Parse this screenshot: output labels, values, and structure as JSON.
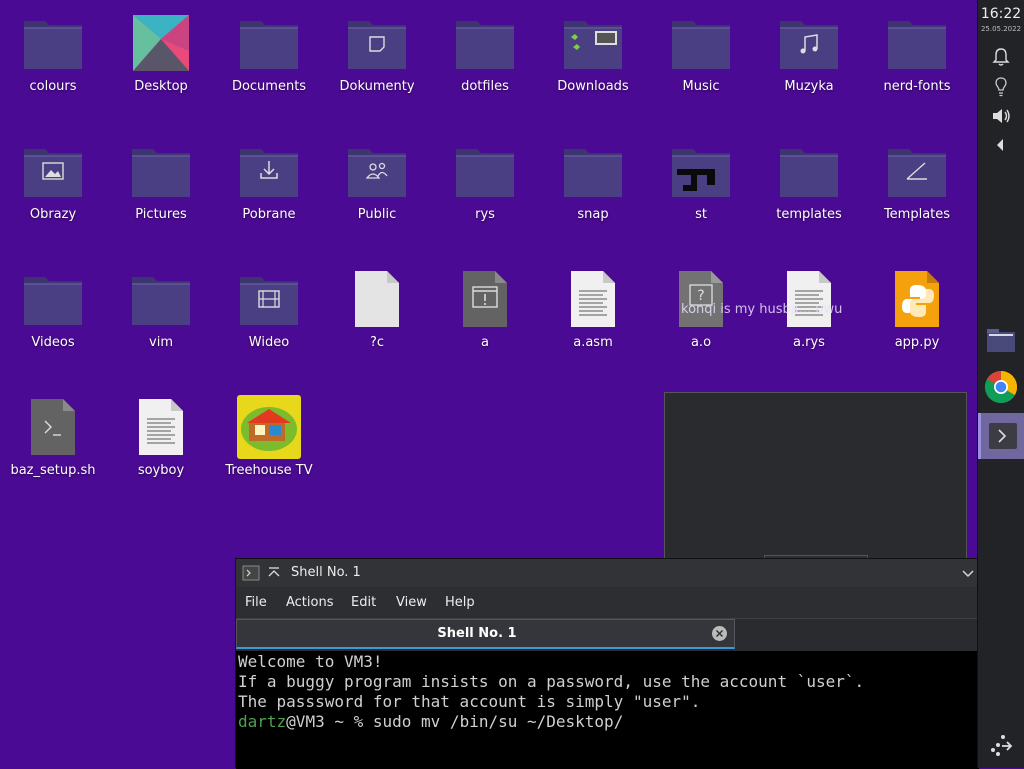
{
  "desktop": {
    "icons": [
      {
        "label": "colours",
        "type": "folder"
      },
      {
        "label": "Desktop",
        "type": "image"
      },
      {
        "label": "Documents",
        "type": "folder"
      },
      {
        "label": "Dokumenty",
        "type": "folder-document"
      },
      {
        "label": "dotfiles",
        "type": "folder"
      },
      {
        "label": "Downloads",
        "type": "folder-thumbnails"
      },
      {
        "label": "Music",
        "type": "folder"
      },
      {
        "label": "Muzyka",
        "type": "folder-music"
      },
      {
        "label": "nerd-fonts",
        "type": "folder"
      },
      {
        "label": "Obrazy",
        "type": "folder-pictures"
      },
      {
        "label": "Pictures",
        "type": "folder"
      },
      {
        "label": "Pobrane",
        "type": "folder-download"
      },
      {
        "label": "Public",
        "type": "folder-users"
      },
      {
        "label": "rys",
        "type": "folder"
      },
      {
        "label": "snap",
        "type": "folder"
      },
      {
        "label": "st",
        "type": "folder-st"
      },
      {
        "label": "templates",
        "type": "folder"
      },
      {
        "label": "Templates",
        "type": "folder-templates"
      },
      {
        "label": "Videos",
        "type": "folder"
      },
      {
        "label": "vim",
        "type": "folder"
      },
      {
        "label": "Wideo",
        "type": "folder-video"
      },
      {
        "label": "?c",
        "type": "file-blank"
      },
      {
        "label": "a",
        "type": "file-executable"
      },
      {
        "label": "a.asm",
        "type": "file-text"
      },
      {
        "label": "a.o",
        "type": "file-unknown"
      },
      {
        "label": "a.rys",
        "type": "file-text"
      },
      {
        "label": "app.py",
        "type": "file-python"
      },
      {
        "label": "baz_setup.sh",
        "type": "file-shell"
      },
      {
        "label": "soyboy",
        "type": "file-text"
      },
      {
        "label": "Treehouse TV",
        "type": "image-treehouse"
      }
    ],
    "tooltip": "konqi is my husba... uwu"
  },
  "panel": {
    "clock_time": "16:22",
    "clock_date": "25.05.2022",
    "tray_icons": [
      "bell-icon",
      "lightbulb-icon",
      "volume-icon",
      "arrow-left-icon"
    ]
  },
  "terminal": {
    "title": "Shell No. 1",
    "menu": [
      "File",
      "Actions",
      "Edit",
      "View",
      "Help"
    ],
    "tab_label": "Shell No. 1",
    "lines": [
      "Welcome to VM3!",
      "If a buggy program insists on a password, use the account `user`.",
      "The passsword for that account is simply \"user\".",
      ""
    ],
    "prompt_user": "dartz",
    "prompt_rest": "@VM3 ~ % sudo mv /bin/su ~/Desktop/"
  },
  "colors": {
    "desktop_bg": "#4b0a93",
    "folder": "#4a3f82",
    "accent": "#3a9bdc"
  }
}
